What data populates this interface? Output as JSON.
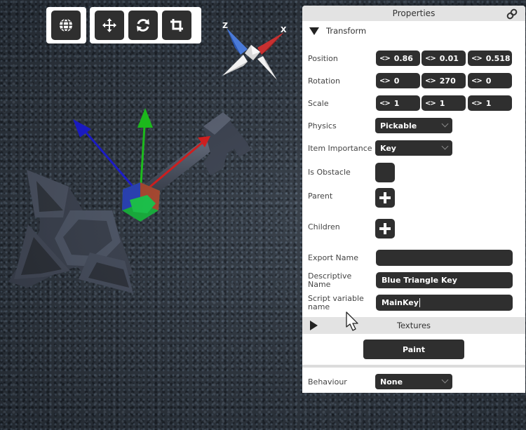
{
  "toolbar": {
    "left_group": [
      {
        "icon": "globe-icon"
      }
    ],
    "right_group": [
      {
        "icon": "move-icon"
      },
      {
        "icon": "rotate-icon"
      },
      {
        "icon": "crop-icon"
      }
    ]
  },
  "gizmo": {
    "x_label": "X",
    "z_label": "Z"
  },
  "properties": {
    "title": "Properties",
    "transform": {
      "label": "Transform",
      "position": {
        "label": "Position",
        "x": "0.86",
        "y": "0.01",
        "z": "0.518"
      },
      "rotation": {
        "label": "Rotation",
        "x": "0",
        "y": "270",
        "z": "0"
      },
      "scale": {
        "label": "Scale",
        "x": "1",
        "y": "1",
        "z": "1"
      },
      "physics": {
        "label": "Physics",
        "value": "Pickable"
      },
      "item_importance": {
        "label": "Item Importance",
        "value": "Key"
      },
      "is_obstacle": {
        "label": "Is Obstacle"
      },
      "parent": {
        "label": "Parent"
      },
      "children": {
        "label": "Children"
      },
      "export_name": {
        "label": "Export Name",
        "value": ""
      },
      "descriptive_name": {
        "label_line1": "Descriptive",
        "label_line2": "Name",
        "value": "Blue Triangle Key"
      },
      "script_variable_name": {
        "label_line1": "Script variable",
        "label_line2": "name",
        "value": "MainKey"
      }
    },
    "textures": {
      "label": "Textures",
      "paint_label": "Paint"
    },
    "behaviour": {
      "label": "Behaviour",
      "value": "None"
    }
  },
  "colors": {
    "button_dark": "#2f2f2f",
    "axis_x": "#e01818",
    "axis_y": "#18d018",
    "axis_z": "#1818e0",
    "panel_header": "#e3e3e3"
  }
}
